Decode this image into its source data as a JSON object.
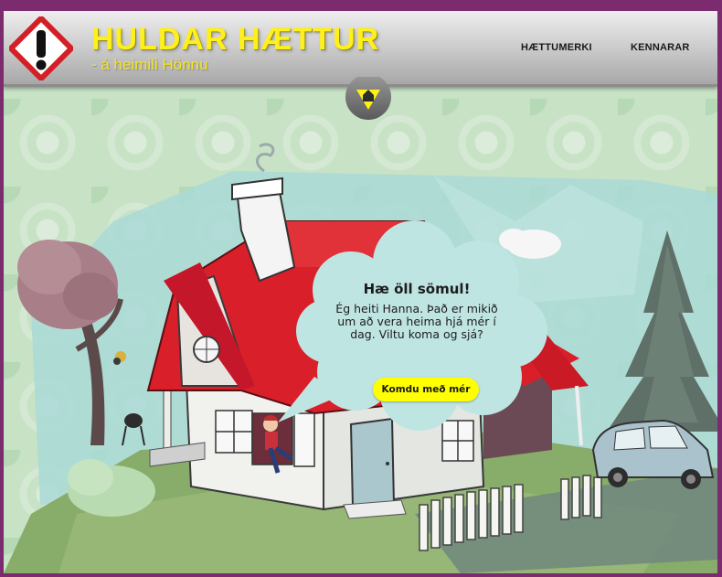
{
  "header": {
    "title": "HULDAR HÆTTUR",
    "subtitle": "- á heimili Hönnu",
    "nav": [
      {
        "label": "HÆTTUMERKI"
      },
      {
        "label": "KENNARAR"
      }
    ]
  },
  "bubble": {
    "title": "Hæ öll sömul!",
    "body": "Ég heiti Hanna. Það er mikið um að vera heima hjá mér í dag. Viltu koma og sjá?",
    "button_label": "Komdu með mér"
  },
  "icons": {
    "logo": "hazard-exclamation-icon",
    "home": "home-icon"
  },
  "colors": {
    "accent_yellow": "#ffef1a",
    "roof_red": "#d81f2a",
    "bubble": "#bfe5e3",
    "frame": "#7a2c6e"
  }
}
